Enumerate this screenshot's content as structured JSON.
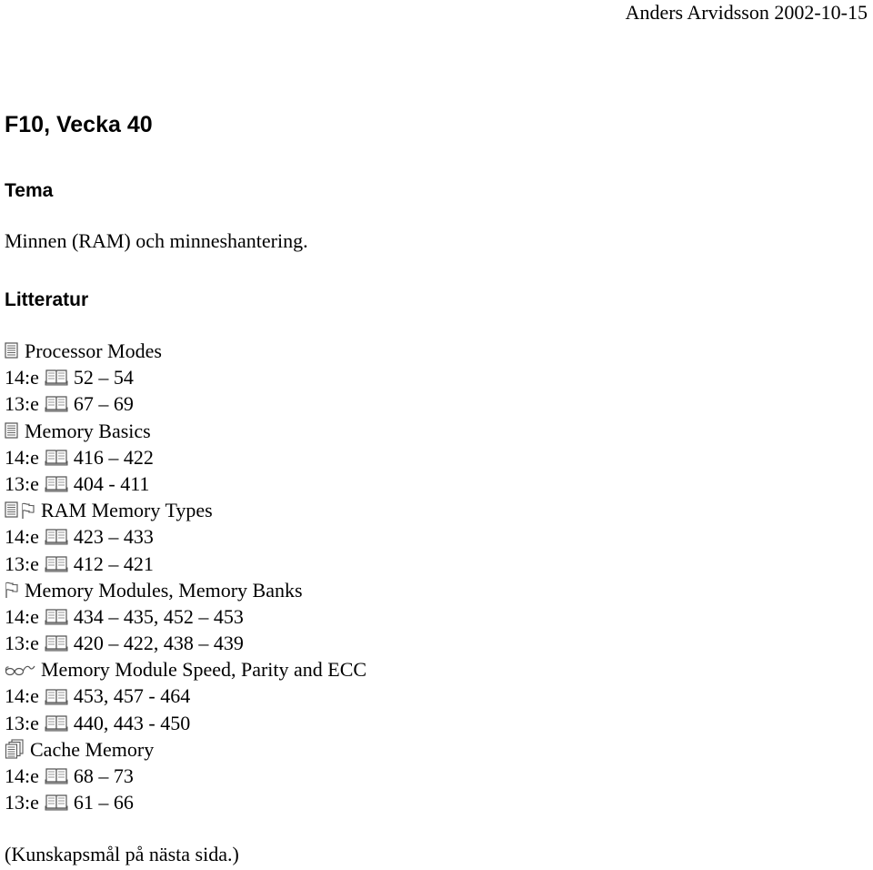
{
  "header": {
    "author_date": "Anders Arvidsson 2002-10-15"
  },
  "title": "F10, Vecka 40",
  "tema": {
    "heading": "Tema",
    "text": "Minnen (RAM) och minneshantering."
  },
  "litteratur": {
    "heading": "Litteratur",
    "items": [
      {
        "type": "topic",
        "icons": [
          "document-icon"
        ],
        "text": "Processor Modes"
      },
      {
        "type": "ref",
        "edition": "14:e",
        "icon": "book-icon",
        "pages": "52 – 54"
      },
      {
        "type": "ref",
        "edition": "13:e",
        "icon": "book-icon",
        "pages": "67 – 69"
      },
      {
        "type": "topic",
        "icons": [
          "document-icon"
        ],
        "text": "Memory Basics"
      },
      {
        "type": "ref",
        "edition": "14:e",
        "icon": "book-icon",
        "pages": "416 – 422"
      },
      {
        "type": "ref",
        "edition": "13:e",
        "icon": "book-icon",
        "pages": "404 - 411"
      },
      {
        "type": "topic",
        "icons": [
          "document-icon",
          "flag-icon"
        ],
        "text": "RAM Memory Types"
      },
      {
        "type": "ref",
        "edition": "14:e",
        "icon": "book-icon",
        "pages": "423 – 433"
      },
      {
        "type": "ref",
        "edition": "13:e",
        "icon": "book-icon",
        "pages": "412 – 421"
      },
      {
        "type": "topic",
        "icons": [
          "flag-icon"
        ],
        "text": "Memory Modules, Memory Banks"
      },
      {
        "type": "ref",
        "edition": "14:e",
        "icon": "book-icon",
        "pages": "434 – 435, 452 – 453"
      },
      {
        "type": "ref",
        "edition": "13:e",
        "icon": "book-icon",
        "pages": "420 – 422, 438 – 439"
      },
      {
        "type": "topic",
        "icons": [
          "glasses-icon"
        ],
        "text": "Memory Module Speed, Parity and ECC"
      },
      {
        "type": "ref",
        "edition": "14:e",
        "icon": "book-icon",
        "pages": "453, 457 - 464"
      },
      {
        "type": "ref",
        "edition": "13:e",
        "icon": "book-icon",
        "pages": "440, 443 - 450"
      },
      {
        "type": "topic",
        "icons": [
          "documents-icon"
        ],
        "text": "Cache Memory"
      },
      {
        "type": "ref",
        "edition": "14:e",
        "icon": "book-icon",
        "pages": "68 – 73"
      },
      {
        "type": "ref",
        "edition": "13:e",
        "icon": "book-icon",
        "pages": "61 – 66"
      }
    ]
  },
  "footer_note": "(Kunskapsmål på nästa sida.)"
}
